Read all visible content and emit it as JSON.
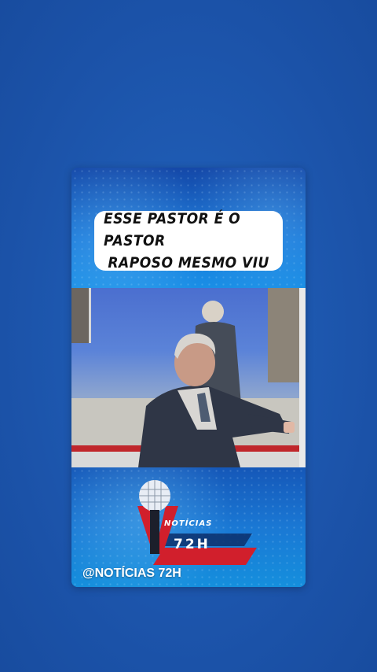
{
  "caption": {
    "line1": "ESSE PASTOR É O PASTOR",
    "line2": "RAPOSO MESMO VIU"
  },
  "logo": {
    "name_top": "NOTÍCIAS",
    "name_bottom": "72H",
    "icon": "microphone-icon"
  },
  "handle": "@NOTÍCIAS 72H",
  "colors": {
    "background": "#1d56ad",
    "logo_red": "#d11f2c",
    "accent_blue": "#1a78d4"
  }
}
